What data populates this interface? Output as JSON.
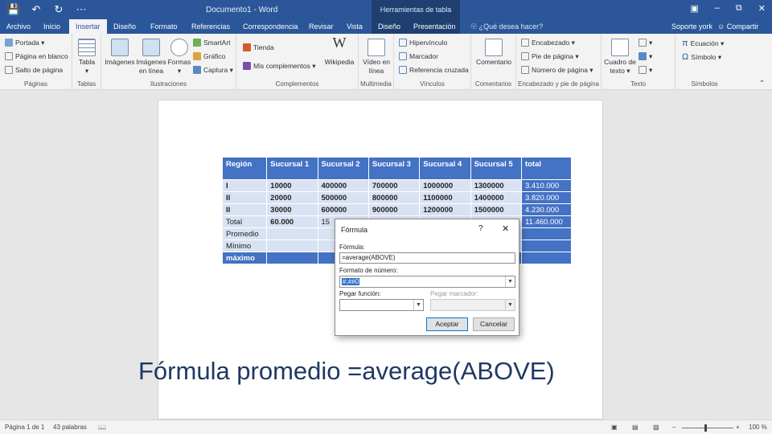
{
  "window": {
    "doc_title": "Documento1 - Word",
    "context_group": "Herramientas de tabla",
    "qat": [
      "save-icon",
      "undo-icon",
      "redo-icon",
      "customize-icon"
    ]
  },
  "tabs": [
    "Archivo",
    "Inicio",
    "Insertar",
    "Diseño",
    "Formato",
    "Referencias",
    "Correspondencia",
    "Revisar",
    "Vista",
    "Diseño",
    "Presentación"
  ],
  "tell_me": "¿Qué desea hacer?",
  "user": "Soporte york",
  "share": "Compartir",
  "ribbon": {
    "paginas": {
      "label": "Páginas",
      "items": [
        "Portada",
        "Página en blanco",
        "Salto de página"
      ]
    },
    "tablas": {
      "label": "Tablas",
      "tabla": "Tabla"
    },
    "ilustraciones": {
      "label": "Ilustraciones",
      "imagenes": "Imágenes",
      "imagenes_linea": "Imágenes en línea",
      "formas": "Formas",
      "smartart": "SmartArt",
      "grafico": "Gráfico",
      "captura": "Captura"
    },
    "complementos": {
      "label": "Complementos",
      "tienda": "Tienda",
      "mis": "Mis complementos",
      "wikipedia": "Wikipedia"
    },
    "multimedia": {
      "label": "Multimedia",
      "video": "Vídeo en línea"
    },
    "vinculos": {
      "label": "Vínculos",
      "items": [
        "Hipervínculo",
        "Marcador",
        "Referencia cruzada"
      ]
    },
    "comentarios": {
      "label": "Comentarios",
      "comentario": "Comentario"
    },
    "encabezado": {
      "label": "Encabezado y pie de página",
      "items": [
        "Encabezado",
        "Pie de página",
        "Número de página"
      ]
    },
    "texto": {
      "label": "Texto",
      "cuadro": "Cuadro de texto"
    },
    "simbolos": {
      "label": "Símbolos",
      "ecuacion": "Ecuación",
      "simbolo": "Símbolo"
    }
  },
  "table": {
    "headers": [
      "Región",
      "Sucursal 1",
      "Sucursal 2",
      "Sucursal 3",
      "Sucursal 4",
      "Sucursal 5",
      "total"
    ],
    "rows": [
      [
        "I",
        "10000",
        "400000",
        "700000",
        "1000000",
        "1300000",
        "3.410.000"
      ],
      [
        "II",
        "20000",
        "500000",
        "800000",
        "1100000",
        "1400000",
        "3.820.000"
      ],
      [
        "II",
        "30000",
        "600000",
        "900000",
        "1200000",
        "1500000",
        "4.230.000"
      ]
    ],
    "total_row": [
      "Total",
      "60.000",
      "15",
      "",
      "",
      "",
      "11.460.000"
    ],
    "promedio": "Promedio",
    "minimo": "Mínimo",
    "maximo": "máximo"
  },
  "dialog": {
    "title": "Fórmula",
    "help": "?",
    "close": "✕",
    "formula_label": "Fórmula:",
    "formula_value": "=average(ABOVE)",
    "format_label": "Formato de número:",
    "format_value": "#,##0",
    "paste_function_label": "Pegar función:",
    "paste_bookmark_label": "Pegar marcador:",
    "ok": "Aceptar",
    "cancel": "Cancelar"
  },
  "caption": "Fórmula promedio =average(ABOVE)",
  "status": {
    "page": "Página 1 de 1",
    "words": "43 palabras",
    "zoom": "100 %"
  }
}
